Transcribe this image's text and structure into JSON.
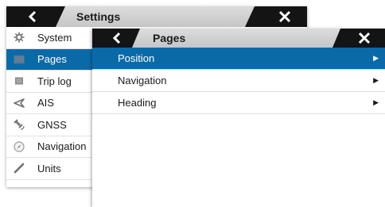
{
  "settings": {
    "title": "Settings",
    "back_icon": "chevron-left-icon",
    "close_icon": "close-icon",
    "items": [
      {
        "label": "System",
        "icon": "gear-icon"
      },
      {
        "label": "Pages",
        "icon": "pages-icon",
        "selected": true
      },
      {
        "label": "Trip log",
        "icon": "trip-log-icon"
      },
      {
        "label": "AIS",
        "icon": "ais-icon"
      },
      {
        "label": "GNSS",
        "icon": "gnss-icon"
      },
      {
        "label": "Navigation",
        "icon": "compass-icon"
      },
      {
        "label": "Units",
        "icon": "ruler-icon"
      }
    ]
  },
  "pages": {
    "title": "Pages",
    "back_icon": "chevron-left-icon",
    "close_icon": "close-icon",
    "items": [
      {
        "label": "Position",
        "selected": true
      },
      {
        "label": "Navigation"
      },
      {
        "label": "Heading"
      }
    ]
  },
  "colors": {
    "accent": "#0a6aa8",
    "titlebar": "#141414",
    "title_plate": "#d0d0d0"
  }
}
